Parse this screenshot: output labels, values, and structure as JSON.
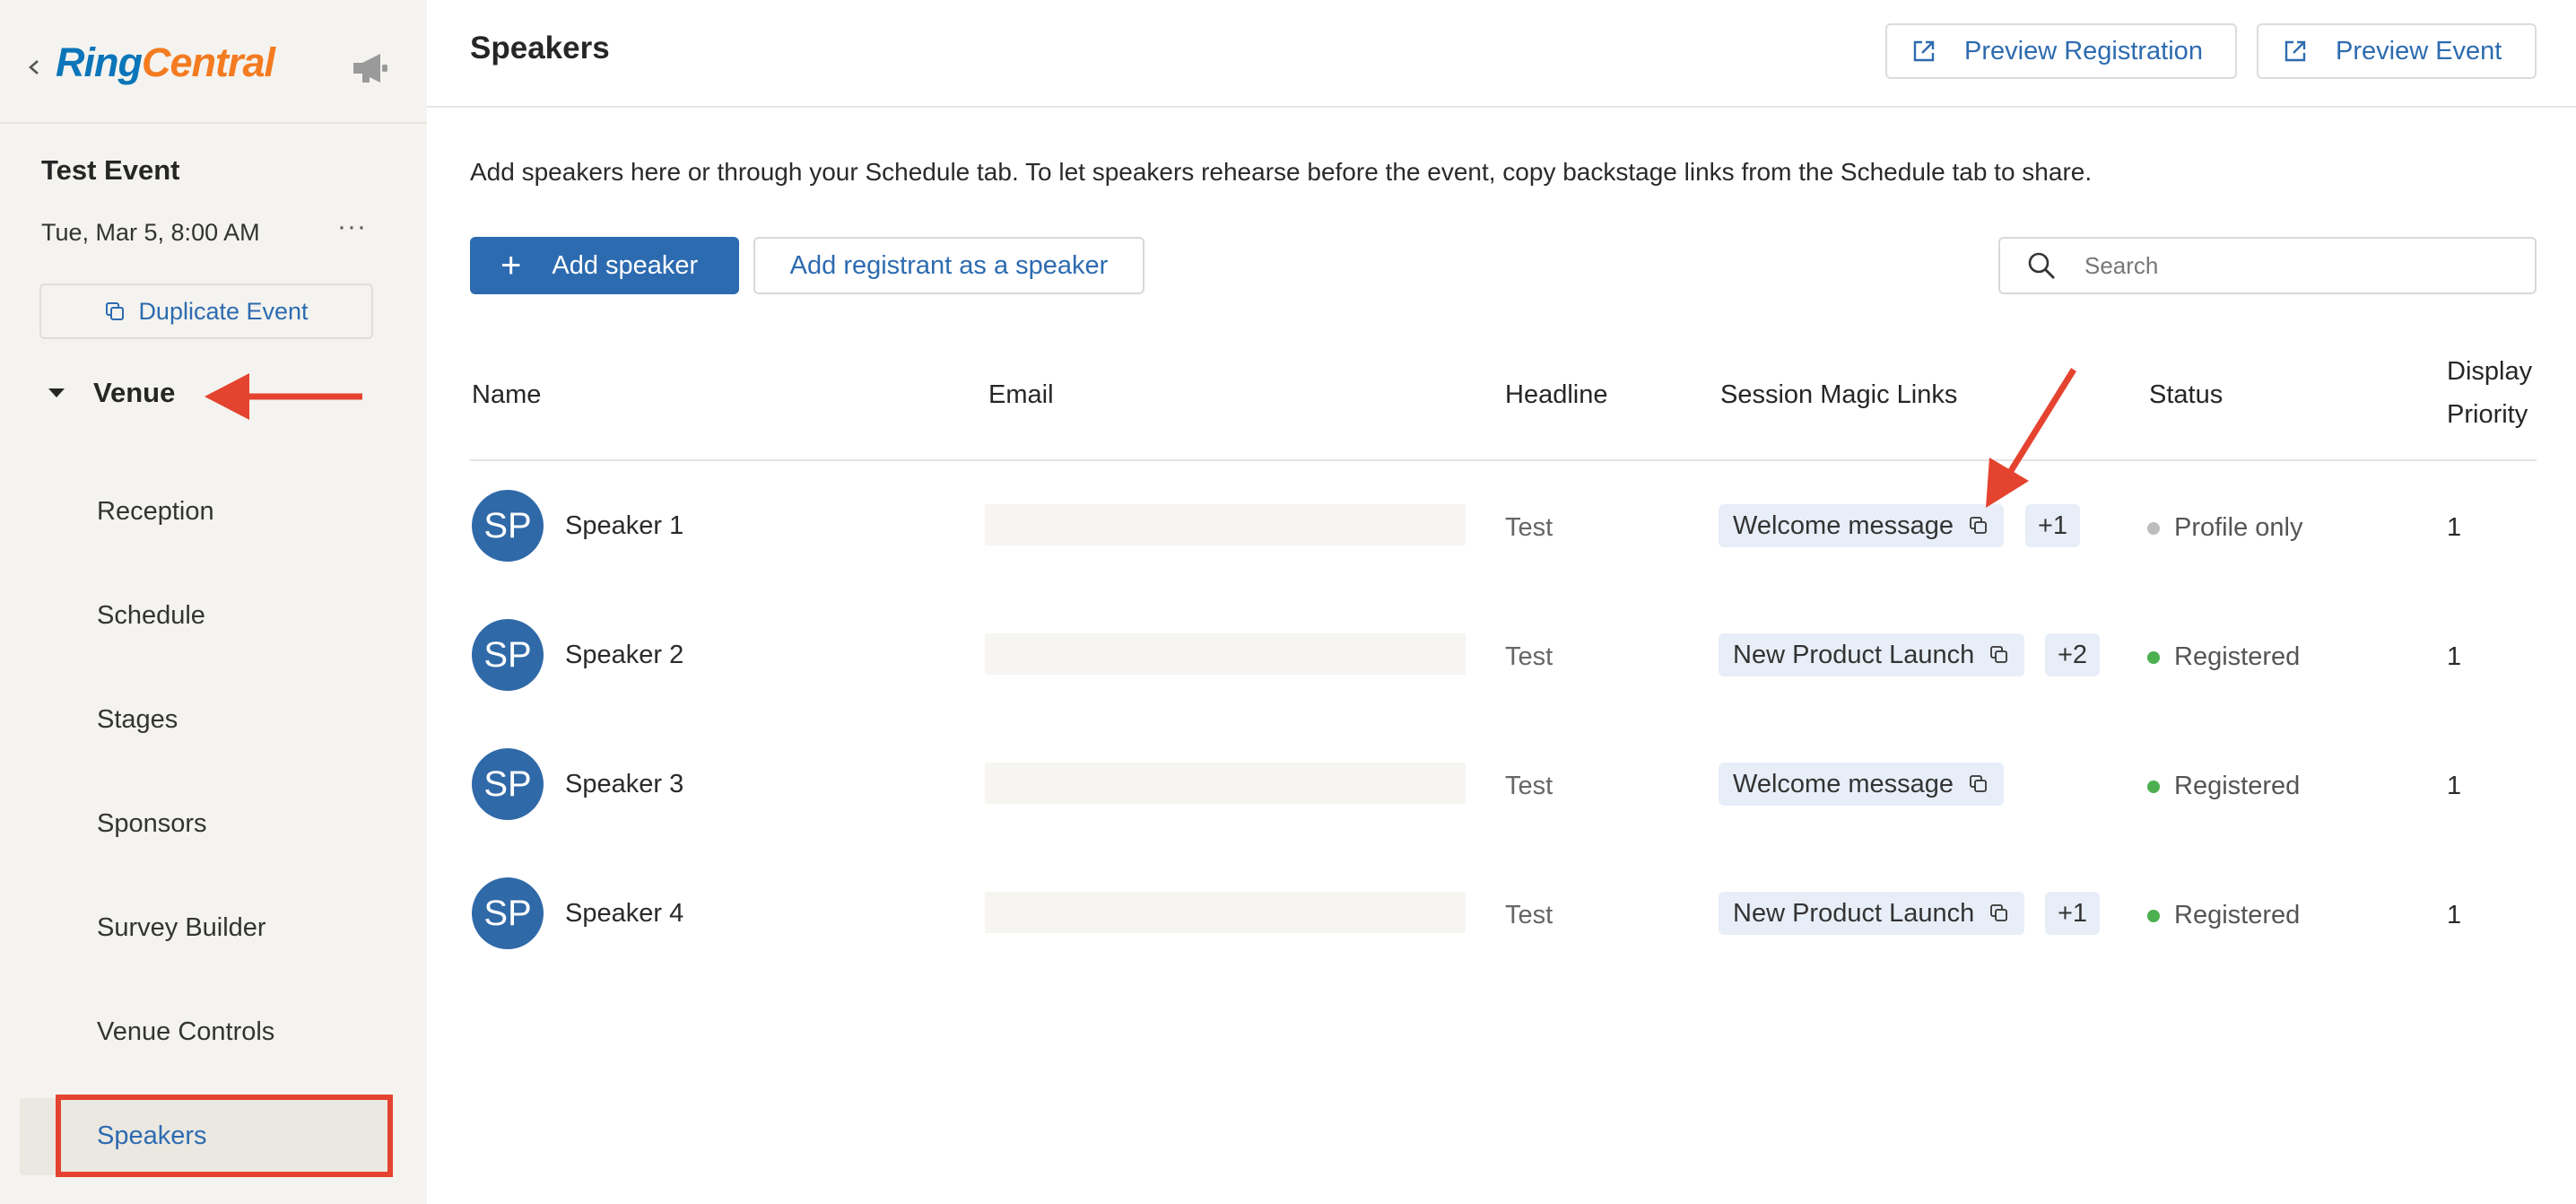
{
  "sidebar": {
    "logo_ring": "Ring",
    "logo_central": "Central",
    "event_title": "Test Event",
    "event_date": "Tue, Mar 5, 8:00 AM",
    "more_label": "···",
    "duplicate_label": "Duplicate Event",
    "section_label": "Venue",
    "items": [
      {
        "label": "Reception"
      },
      {
        "label": "Schedule"
      },
      {
        "label": "Stages"
      },
      {
        "label": "Sponsors"
      },
      {
        "label": "Survey Builder"
      },
      {
        "label": "Venue Controls"
      },
      {
        "label": "Speakers",
        "active": true
      }
    ]
  },
  "header": {
    "title": "Speakers",
    "preview_registration": "Preview Registration",
    "preview_event": "Preview Event"
  },
  "main": {
    "intro": "Add speakers here or through your Schedule tab. To let speakers rehearse before the event, copy backstage links from the Schedule tab to share.",
    "add_speaker": "Add speaker",
    "add_registrant": "Add registrant as a speaker",
    "search_placeholder": "Search"
  },
  "table": {
    "columns": [
      "Name",
      "Email",
      "Headline",
      "Session Magic Links",
      "Status",
      "Display",
      "Priority"
    ],
    "rows": [
      {
        "initials": "SP",
        "name": "Speaker 1",
        "headline": "Test",
        "link": "Welcome message",
        "more": "+1",
        "status": "Profile only",
        "priority": "1"
      },
      {
        "initials": "SP",
        "name": "Speaker 2",
        "headline": "Test",
        "link": "New Product Launch",
        "more": "+2",
        "status": "Registered",
        "priority": "1"
      },
      {
        "initials": "SP",
        "name": "Speaker 3",
        "headline": "Test",
        "link": "Welcome message",
        "more": "",
        "status": "Registered",
        "priority": "1"
      },
      {
        "initials": "SP",
        "name": "Speaker 4",
        "headline": "Test",
        "link": "New Product Launch",
        "more": "+1",
        "status": "Registered",
        "priority": "1"
      }
    ]
  },
  "colors": {
    "accent": "#2d6bb0",
    "status_registered": "#4caf50",
    "status_profile_only": "#bdbdbd",
    "annotation_red": "#e4432f"
  },
  "icons": {
    "back": "chevron-left-icon",
    "announcement": "megaphone-icon",
    "duplicate": "copy-icon",
    "collapse": "caret-down-icon",
    "external": "external-link-icon",
    "add": "plus-icon",
    "search": "search-icon",
    "copy_link": "copy-icon"
  }
}
